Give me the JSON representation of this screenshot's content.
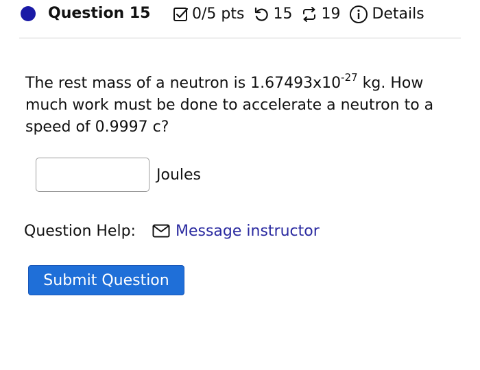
{
  "header": {
    "question_label": "Question 15",
    "points": "0/5 pts",
    "retry_count": "15",
    "attempts": "19",
    "details_label": "Details",
    "status_color": "#1a1aa6"
  },
  "question": {
    "text_before": "The rest mass of a neutron is 1.67493x10",
    "exponent": "-27",
    "text_after": " kg. How much work must be done to accelerate a neutron to a speed of 0.9997 c?"
  },
  "answer": {
    "value": "",
    "unit": "Joules"
  },
  "help": {
    "label": "Question Help:",
    "link_label": "Message instructor",
    "link_icon": "envelope-icon"
  },
  "submit": {
    "label": "Submit Question",
    "color": "#1f6fd8"
  }
}
